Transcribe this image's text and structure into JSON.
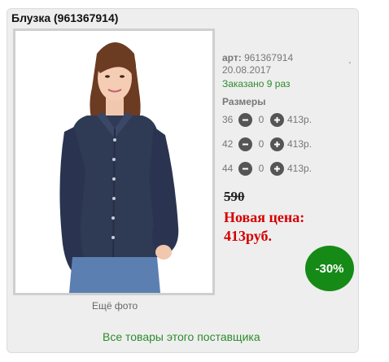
{
  "product": {
    "title": "Блузка (961367914)",
    "art_label": "арт:",
    "art_value": "961367914",
    "date": "20.08.2017",
    "ordered": "Заказано 9 раз",
    "sizes_heading": "Размеры",
    "tick_mark": "'",
    "sizes": [
      {
        "size": "36",
        "qty": "0",
        "price": "413р."
      },
      {
        "size": "42",
        "qty": "0",
        "price": "413р."
      },
      {
        "size": "44",
        "qty": "0",
        "price": "413р."
      }
    ],
    "old_price": "590",
    "new_price_label": "Новая цена:",
    "new_price_value": "413руб.",
    "discount": "-30%",
    "more_photos": "Ещё фото",
    "supplier_link": "Все товары этого поставщика"
  },
  "icons": {
    "decrease": "minus-circle-icon",
    "increase": "plus-circle-icon"
  },
  "colors": {
    "green_text": "#2e8b2e",
    "red_price": "#d40000",
    "discount_badge": "#168a16",
    "blouse": "#2f3a55",
    "jeans": "#5b7fb0",
    "button_dark": "#555555"
  }
}
